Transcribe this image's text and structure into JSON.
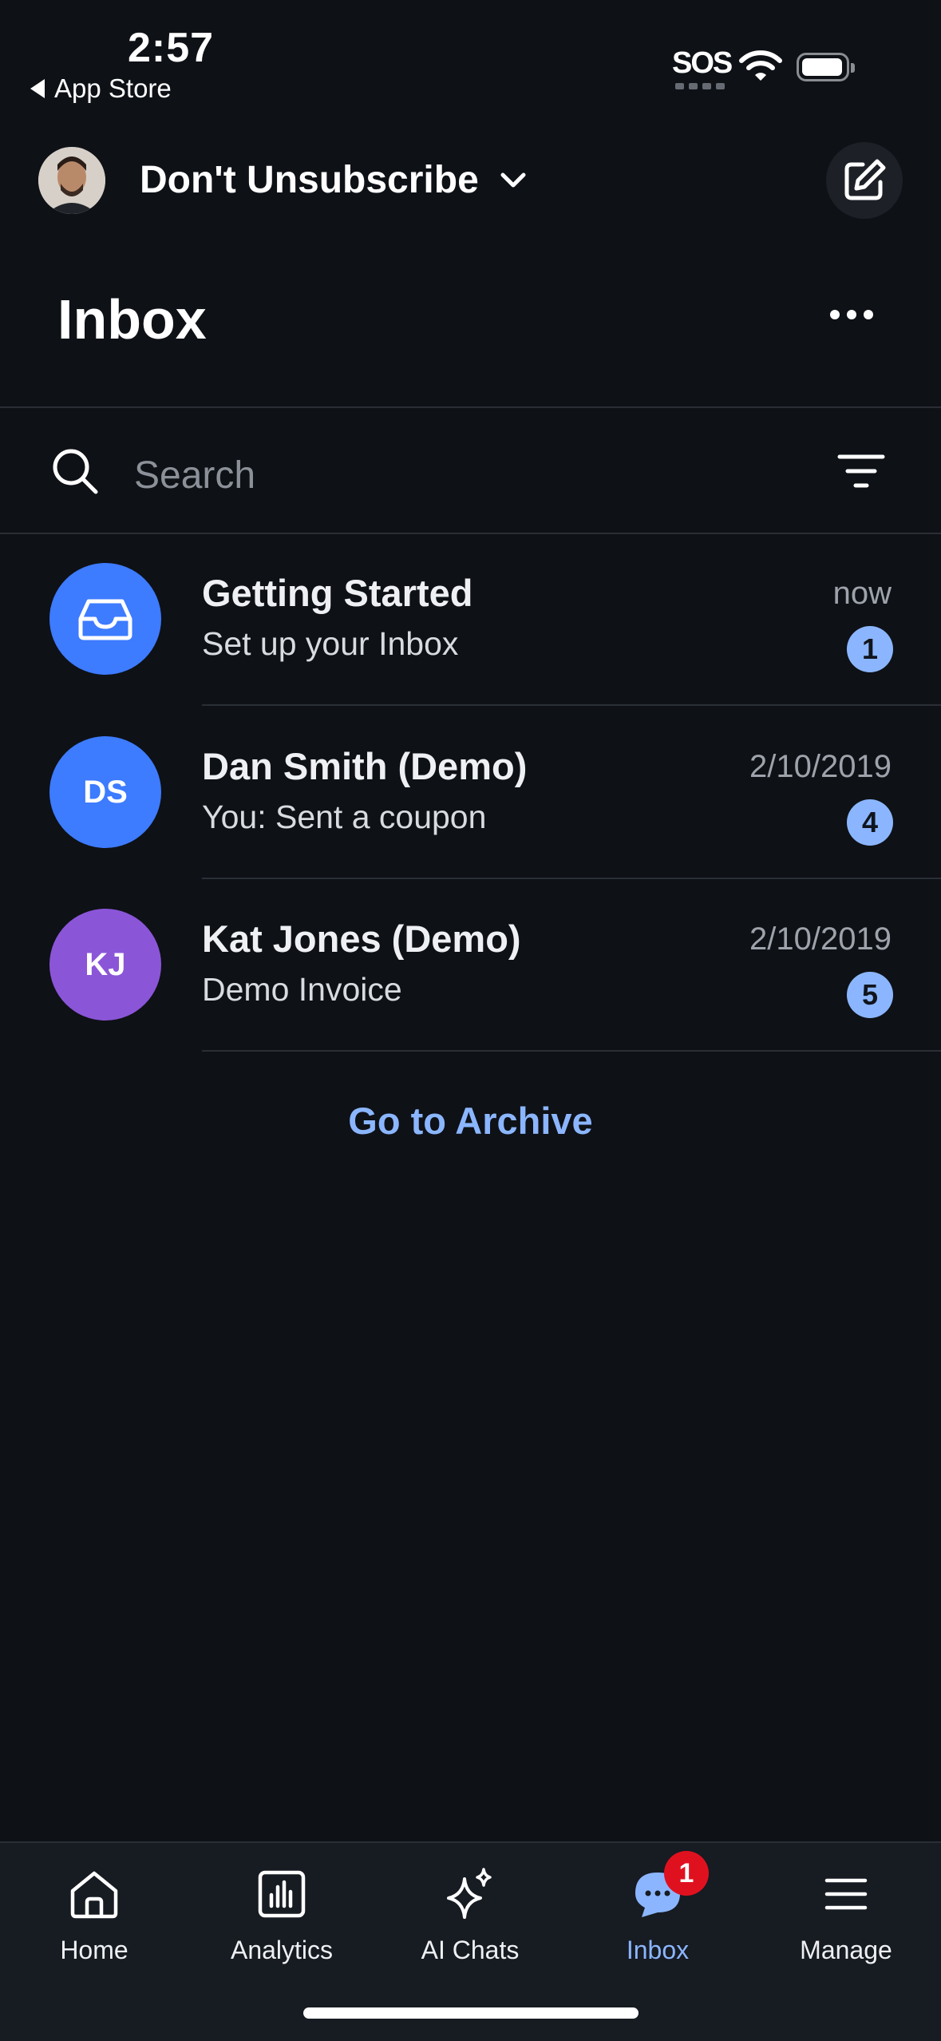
{
  "status_bar": {
    "time": "2:57",
    "back_app": "App Store",
    "sos": "SOS"
  },
  "header": {
    "site_name": "Don't Unsubscribe",
    "title": "Inbox"
  },
  "search": {
    "placeholder": "Search"
  },
  "conversations": [
    {
      "initials": "",
      "icon": "inbox-tray-icon",
      "avatar_color": "#3d7bff",
      "name": "Getting Started",
      "preview": "Set up your Inbox",
      "date": "now",
      "unread": "1"
    },
    {
      "initials": "DS",
      "avatar_color": "#3d7bff",
      "name": "Dan Smith (Demo)",
      "preview": "You: Sent a coupon",
      "date": "2/10/2019",
      "unread": "4"
    },
    {
      "initials": "KJ",
      "avatar_color": "#8b55d8",
      "name": "Kat Jones (Demo)",
      "preview": "Demo Invoice",
      "date": "2/10/2019",
      "unread": "5"
    }
  ],
  "archive_link": "Go to Archive",
  "bottom_nav": {
    "items": [
      {
        "label": "Home",
        "icon": "home-icon"
      },
      {
        "label": "Analytics",
        "icon": "analytics-icon"
      },
      {
        "label": "AI Chats",
        "icon": "sparkle-icon"
      },
      {
        "label": "Inbox",
        "icon": "chat-bubble-icon",
        "badge": "1",
        "active": true
      },
      {
        "label": "Manage",
        "icon": "menu-icon"
      }
    ]
  },
  "colors": {
    "background": "#0e1116",
    "accent": "#8bb6ff",
    "badge_red": "#e0111f"
  }
}
